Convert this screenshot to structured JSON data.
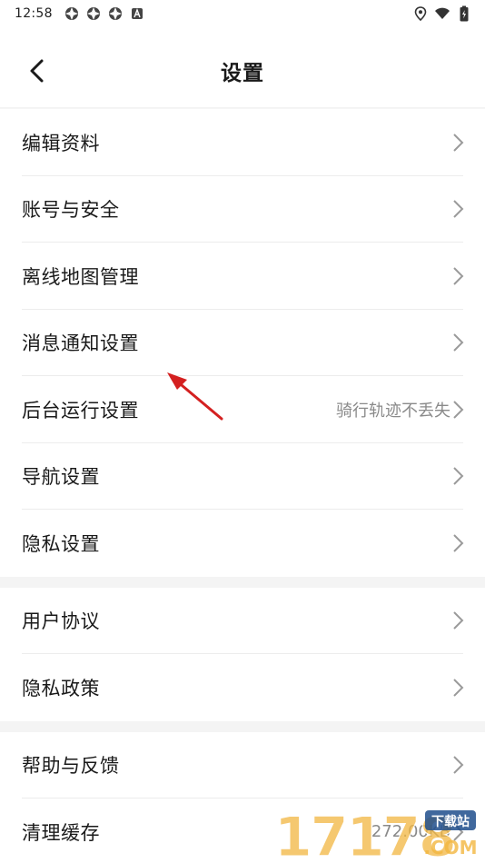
{
  "status_bar": {
    "time": "12:58",
    "left_icons": [
      "notification-icon",
      "notification-icon",
      "notification-icon",
      "app-icon"
    ],
    "right_icons": [
      "location-icon",
      "wifi-icon",
      "battery-icon"
    ]
  },
  "header": {
    "title": "设置",
    "back_icon": "chevron-left-icon"
  },
  "groups": [
    {
      "items": [
        {
          "label": "编辑资料",
          "value": ""
        },
        {
          "label": "账号与安全",
          "value": ""
        },
        {
          "label": "离线地图管理",
          "value": ""
        },
        {
          "label": "消息通知设置",
          "value": ""
        },
        {
          "label": "后台运行设置",
          "value": "骑行轨迹不丢失"
        },
        {
          "label": "导航设置",
          "value": ""
        },
        {
          "label": "隐私设置",
          "value": ""
        }
      ]
    },
    {
      "items": [
        {
          "label": "用户协议",
          "value": ""
        },
        {
          "label": "隐私政策",
          "value": ""
        }
      ]
    },
    {
      "items": [
        {
          "label": "帮助与反馈",
          "value": ""
        },
        {
          "label": "清理缓存",
          "value": "272.00KB"
        }
      ]
    }
  ],
  "watermark": {
    "digits": "17178",
    "tag": "下载站",
    "domain": ".COM"
  },
  "colors": {
    "annotation_arrow": "#d42020",
    "divider": "#ececec",
    "group_gap": "#f4f4f4",
    "secondary_text": "#8a8a8a"
  }
}
